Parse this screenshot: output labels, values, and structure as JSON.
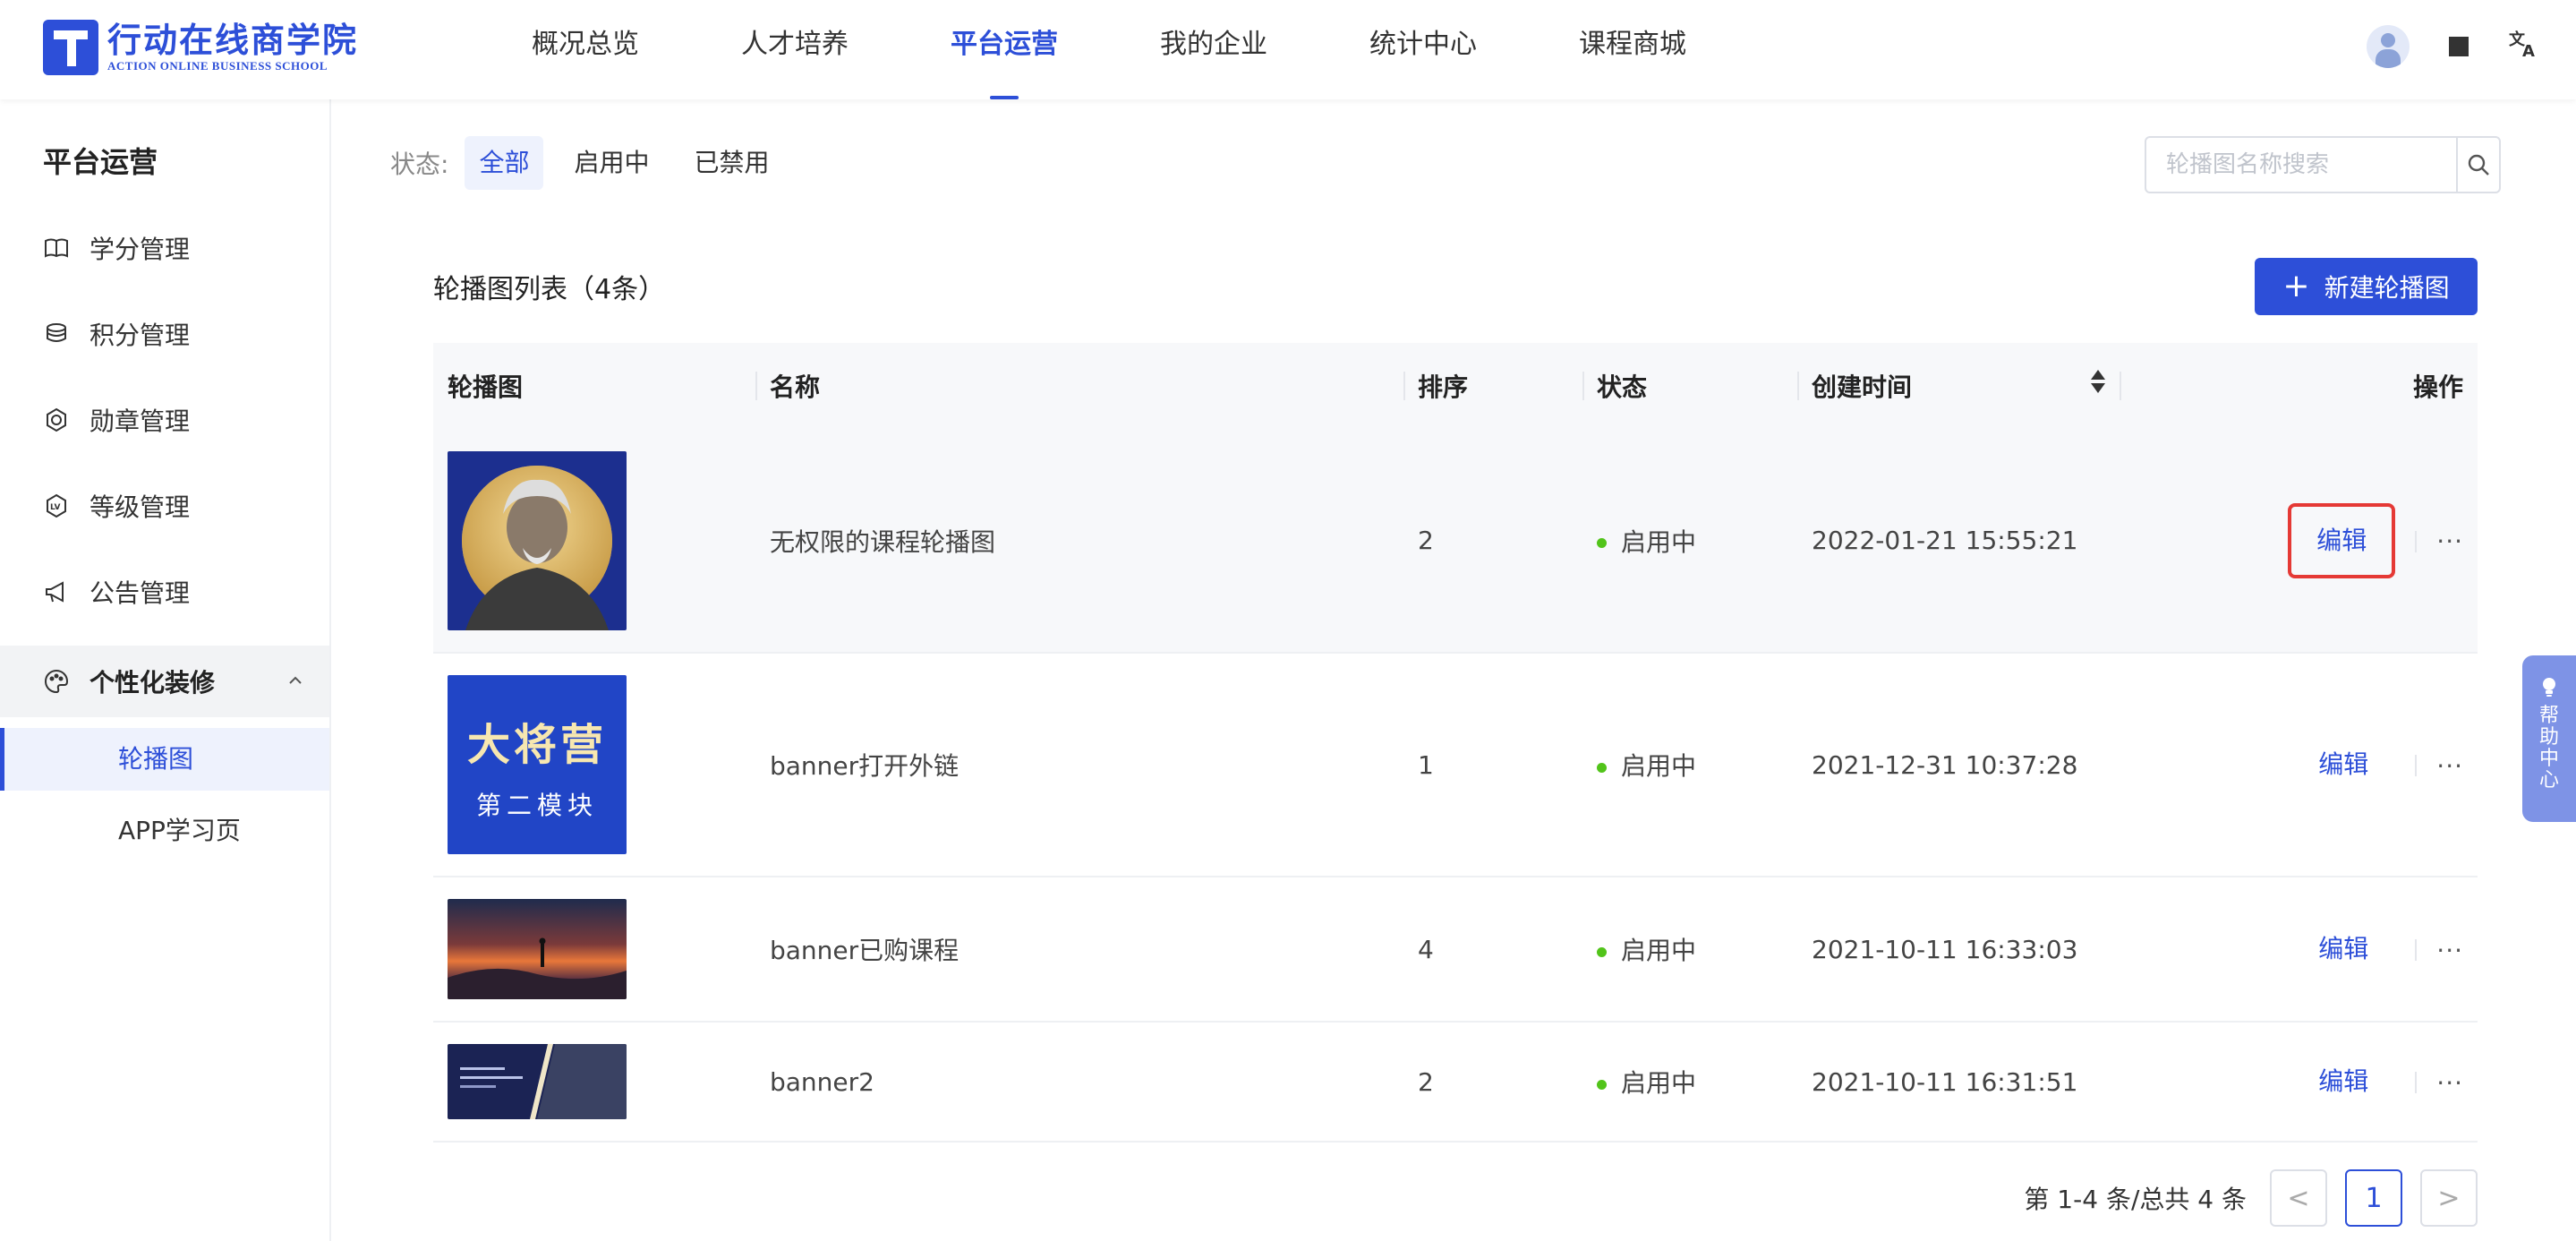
{
  "brand": {
    "name_cn": "行动在线商学院",
    "name_en": "ACTION ONLINE BUSINESS SCHOOL"
  },
  "nav": {
    "items": [
      "概况总览",
      "人才培养",
      "平台运营",
      "我的企业",
      "统计中心",
      "课程商城"
    ],
    "active_index": 2
  },
  "topbar": {
    "translate_glyph": "文A"
  },
  "sidebar": {
    "title": "平台运营",
    "items": [
      "学分管理",
      "积分管理",
      "勋章管理",
      "等级管理",
      "公告管理"
    ],
    "group": {
      "label": "个性化装修",
      "expanded": true,
      "children": [
        "轮播图",
        "APP学习页"
      ],
      "active_child": 0
    }
  },
  "filter": {
    "label": "状态:",
    "options": [
      "全部",
      "启用中",
      "已禁用"
    ],
    "active_index": 0
  },
  "search": {
    "placeholder": "轮播图名称搜索"
  },
  "list": {
    "title": "轮播图列表（4条）",
    "new_button": "新建轮播图"
  },
  "table": {
    "columns": [
      "轮播图",
      "名称",
      "排序",
      "状态",
      "创建时间",
      "操作"
    ],
    "rows": [
      {
        "name": "无权限的课程轮播图",
        "order": "2",
        "status": "启用中",
        "created": "2022-01-21 15:55:21",
        "edit": "编辑",
        "more": "···",
        "thumb_text": "",
        "thumb_sub": ""
      },
      {
        "name": "banner打开外链",
        "order": "1",
        "status": "启用中",
        "created": "2021-12-31 10:37:28",
        "edit": "编辑",
        "more": "···",
        "thumb_text": "大将营",
        "thumb_sub": "第二模块"
      },
      {
        "name": "banner已购课程",
        "order": "4",
        "status": "启用中",
        "created": "2021-10-11 16:33:03",
        "edit": "编辑",
        "more": "···",
        "thumb_text": "",
        "thumb_sub": ""
      },
      {
        "name": "banner2",
        "order": "2",
        "status": "启用中",
        "created": "2021-10-11 16:31:51",
        "edit": "编辑",
        "more": "···",
        "thumb_text": "",
        "thumb_sub": ""
      }
    ]
  },
  "pagination": {
    "summary": "第 1-4 条/总共 4 条",
    "current_page": "1",
    "prev": "<",
    "next": ">"
  },
  "help": {
    "label": "帮助中心"
  },
  "colors": {
    "primary": "#2d4fd8",
    "status_active": "#52c41a",
    "highlight_box": "#e53935"
  }
}
